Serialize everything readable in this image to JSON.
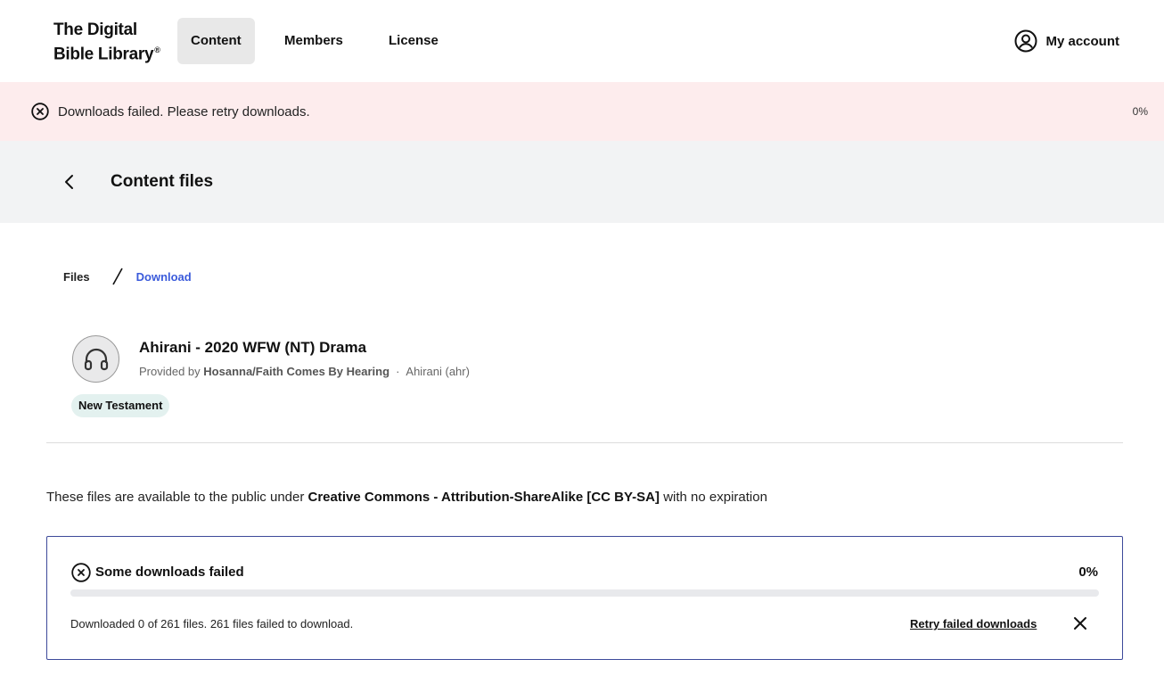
{
  "header": {
    "logo_line1": "The Digital",
    "logo_line2": "Bible Library",
    "logo_reg": "®",
    "nav": [
      {
        "label": "Content",
        "active": true
      },
      {
        "label": "Members",
        "active": false
      },
      {
        "label": "License",
        "active": false
      }
    ],
    "account_label": "My account",
    "account_icon": "user-circle-icon"
  },
  "banner": {
    "icon": "error-circle-x-icon",
    "message": "Downloads failed. Please retry downloads.",
    "percent": "0%",
    "background": "#fdeced"
  },
  "subheader": {
    "back_icon": "chevron-left-icon",
    "title": "Content files"
  },
  "breadcrumb": {
    "files": "Files",
    "current": "Download",
    "current_color": "#3b5bdb"
  },
  "item": {
    "icon": "headphones-icon",
    "title": "Ahirani - 2020 WFW (NT) Drama",
    "provided_by_prefix": "Provided by",
    "provider": "Hosanna/Faith Comes By Hearing",
    "separator": "·",
    "language": "Ahirani (ahr)",
    "tag": "New Testament"
  },
  "license": {
    "prefix": "These files are available to the public under",
    "name": "Creative Commons - Attribution-ShareAlike [CC BY-SA]",
    "suffix": "with no expiration"
  },
  "download": {
    "icon": "error-circle-x-icon",
    "title": "Some downloads failed",
    "percent": "0%",
    "progress": 0,
    "status": "Downloaded 0 of 261 files. 261 files failed to download.",
    "retry_label": "Retry failed downloads",
    "close_icon": "close-icon",
    "accent": "#3d4a9a"
  }
}
